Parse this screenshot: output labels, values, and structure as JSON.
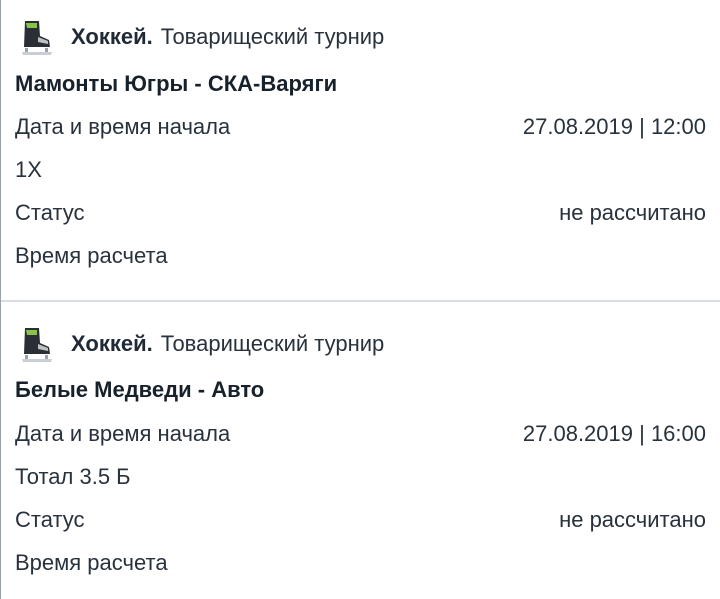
{
  "bets": [
    {
      "sport": "Хоккей.",
      "tournament": "Товарищеский турнир",
      "sport_icon": "hockey-skate-icon",
      "match": "Мамонты Югры - СКА-Варяги",
      "start_label": "Дата и время начала",
      "start_value": "27.08.2019 | 12:00",
      "bet": "1X",
      "status_label": "Статус",
      "status_value": "не рассчитано",
      "settle_label": "Время расчета"
    },
    {
      "sport": "Хоккей.",
      "tournament": "Товарищеский турнир",
      "sport_icon": "hockey-skate-icon",
      "match": "Белые Медведи - Авто",
      "start_label": "Дата и время начала",
      "start_value": "27.08.2019 | 16:00",
      "bet": "Тотал 3.5 Б",
      "status_label": "Статус",
      "status_value": "не рассчитано",
      "settle_label": "Время расчета"
    }
  ],
  "colors": {
    "text": "#27323d",
    "divider": "#d6dde4",
    "skate_boot": "#2a2f36",
    "skate_accent": "#8bc34a",
    "blade": "#c9ced4"
  }
}
